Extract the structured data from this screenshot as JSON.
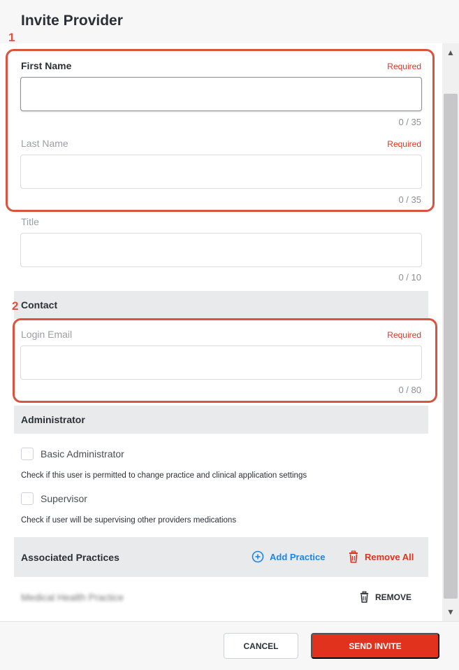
{
  "dialog": {
    "title": "Invite Provider"
  },
  "fields": {
    "first_name": {
      "label": "First Name",
      "required": "Required",
      "value": "",
      "counter": "0 / 35"
    },
    "last_name": {
      "label": "Last Name",
      "required": "Required",
      "value": "",
      "counter": "0 / 35"
    },
    "title": {
      "label": "Title",
      "value": "",
      "counter": "0 / 10"
    },
    "login_email": {
      "label": "Login Email",
      "required": "Required",
      "value": "",
      "counter": "0 / 80"
    }
  },
  "sections": {
    "contact": "Contact",
    "administrator": "Administrator",
    "associated_practices": "Associated Practices"
  },
  "administrator": {
    "basic_admin": {
      "label": "Basic Administrator",
      "checked": false,
      "help": "Check if this user is permitted to change practice and clinical application settings"
    },
    "supervisor": {
      "label": "Supervisor",
      "checked": false,
      "help": "Check if user will be supervising other providers medications"
    }
  },
  "practices": {
    "add_label": "Add Practice",
    "remove_all_label": "Remove All",
    "items": [
      {
        "name": "Medical Health Practice",
        "remove_label": "REMOVE"
      }
    ]
  },
  "footer": {
    "cancel_label": "CANCEL",
    "send_label": "SEND INVITE"
  },
  "annotations": [
    "1",
    "2"
  ],
  "colors": {
    "accent": "#e0321c",
    "link": "#1a86e8",
    "annotation": "#d9533f"
  }
}
